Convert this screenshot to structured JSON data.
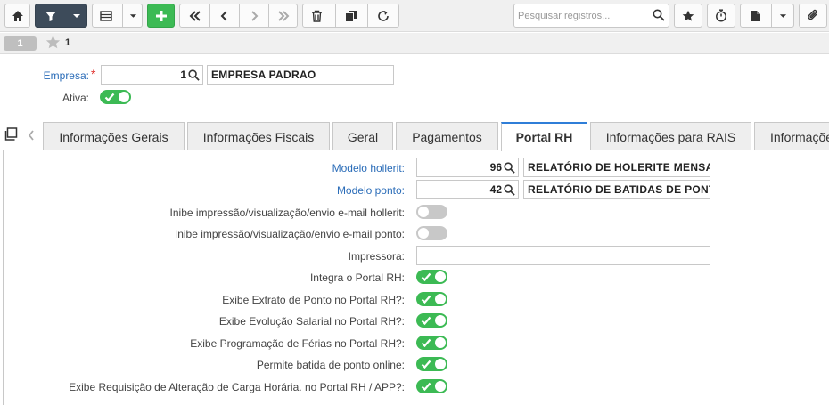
{
  "toolbar": {
    "search_placeholder": "Pesquisar registros...",
    "icons": [
      "home-icon",
      "filter-icon",
      "chevron-down-icon",
      "list-icon",
      "chevron-down-icon",
      "plus-icon",
      "double-chevron-left-icon",
      "chevron-left-icon",
      "chevron-right-icon",
      "double-chevron-right-icon",
      "trash-icon",
      "copy-icon",
      "refresh-icon",
      "search-icon",
      "star-icon",
      "stopwatch-icon",
      "document-icon",
      "chevron-down-icon",
      "paperclip-icon"
    ]
  },
  "record_bar": {
    "pill": "1",
    "record_number": "1"
  },
  "header": {
    "empresa_label": "Empresa:",
    "empresa_code": "1",
    "empresa_name": "EMPRESA PADRAO",
    "ativa_label": "Ativa:",
    "ativa_on": true
  },
  "tabs": [
    {
      "label": "Informações Gerais",
      "active": false
    },
    {
      "label": "Informações Fiscais",
      "active": false
    },
    {
      "label": "Geral",
      "active": false
    },
    {
      "label": "Pagamentos",
      "active": false
    },
    {
      "label": "Portal RH",
      "active": true
    },
    {
      "label": "Informações para RAIS",
      "active": false
    },
    {
      "label": "Informações",
      "active": false
    }
  ],
  "portal_rh": {
    "modelo_holerite_label": "Modelo hollerit:",
    "modelo_holerite_code": "96",
    "modelo_holerite_desc": "RELATÓRIO DE HOLERITE MENSAL",
    "modelo_ponto_label": "Modelo ponto:",
    "modelo_ponto_code": "42",
    "modelo_ponto_desc": "RELATÓRIO DE BATIDAS DE PONTO",
    "impressora_label": "Impressora:",
    "impressora_value": "",
    "toggles": [
      {
        "label": "Inibe impressão/visualização/envio e-mail hollerit:",
        "on": false
      },
      {
        "label": "Inibe impressão/visualização/envio e-mail ponto:",
        "on": false
      },
      {
        "label": "Integra o Portal RH:",
        "on": true
      },
      {
        "label": "Exibe Extrato de Ponto no Portal RH?:",
        "on": true
      },
      {
        "label": "Exibe Evolução Salarial no Portal RH?:",
        "on": true
      },
      {
        "label": "Exibe Programação de Férias no Portal RH?:",
        "on": true
      },
      {
        "label": "Permite batida de ponto online:",
        "on": true
      },
      {
        "label": "Exibe Requisição de Alteração de Carga Horária. no Portal RH / APP?:",
        "on": true
      }
    ]
  },
  "colors": {
    "accent": "#2f7ed8",
    "toggle_on": "#3cba54",
    "toggle_off": "#c8c8c8",
    "link_label": "#2a6cb8",
    "required": "#e0312d",
    "dark_button": "#3d4b5a"
  }
}
